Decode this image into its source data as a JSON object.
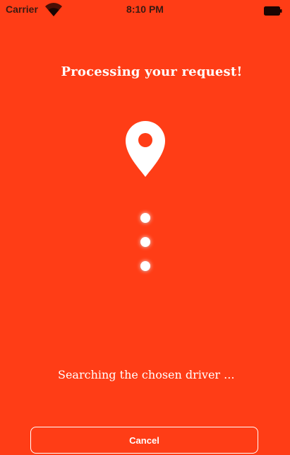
{
  "status_bar": {
    "carrier": "Carrier",
    "time": "8:10 PM",
    "wifi_icon": "wifi-icon",
    "battery_icon": "battery-icon"
  },
  "screen": {
    "title": "Processing your request!",
    "pin_icon": "location-pin-icon",
    "status": "Searching the chosen driver ...",
    "cancel_label": "Cancel"
  },
  "colors": {
    "background": "#FF3D16",
    "foreground": "#FFFFFF"
  }
}
